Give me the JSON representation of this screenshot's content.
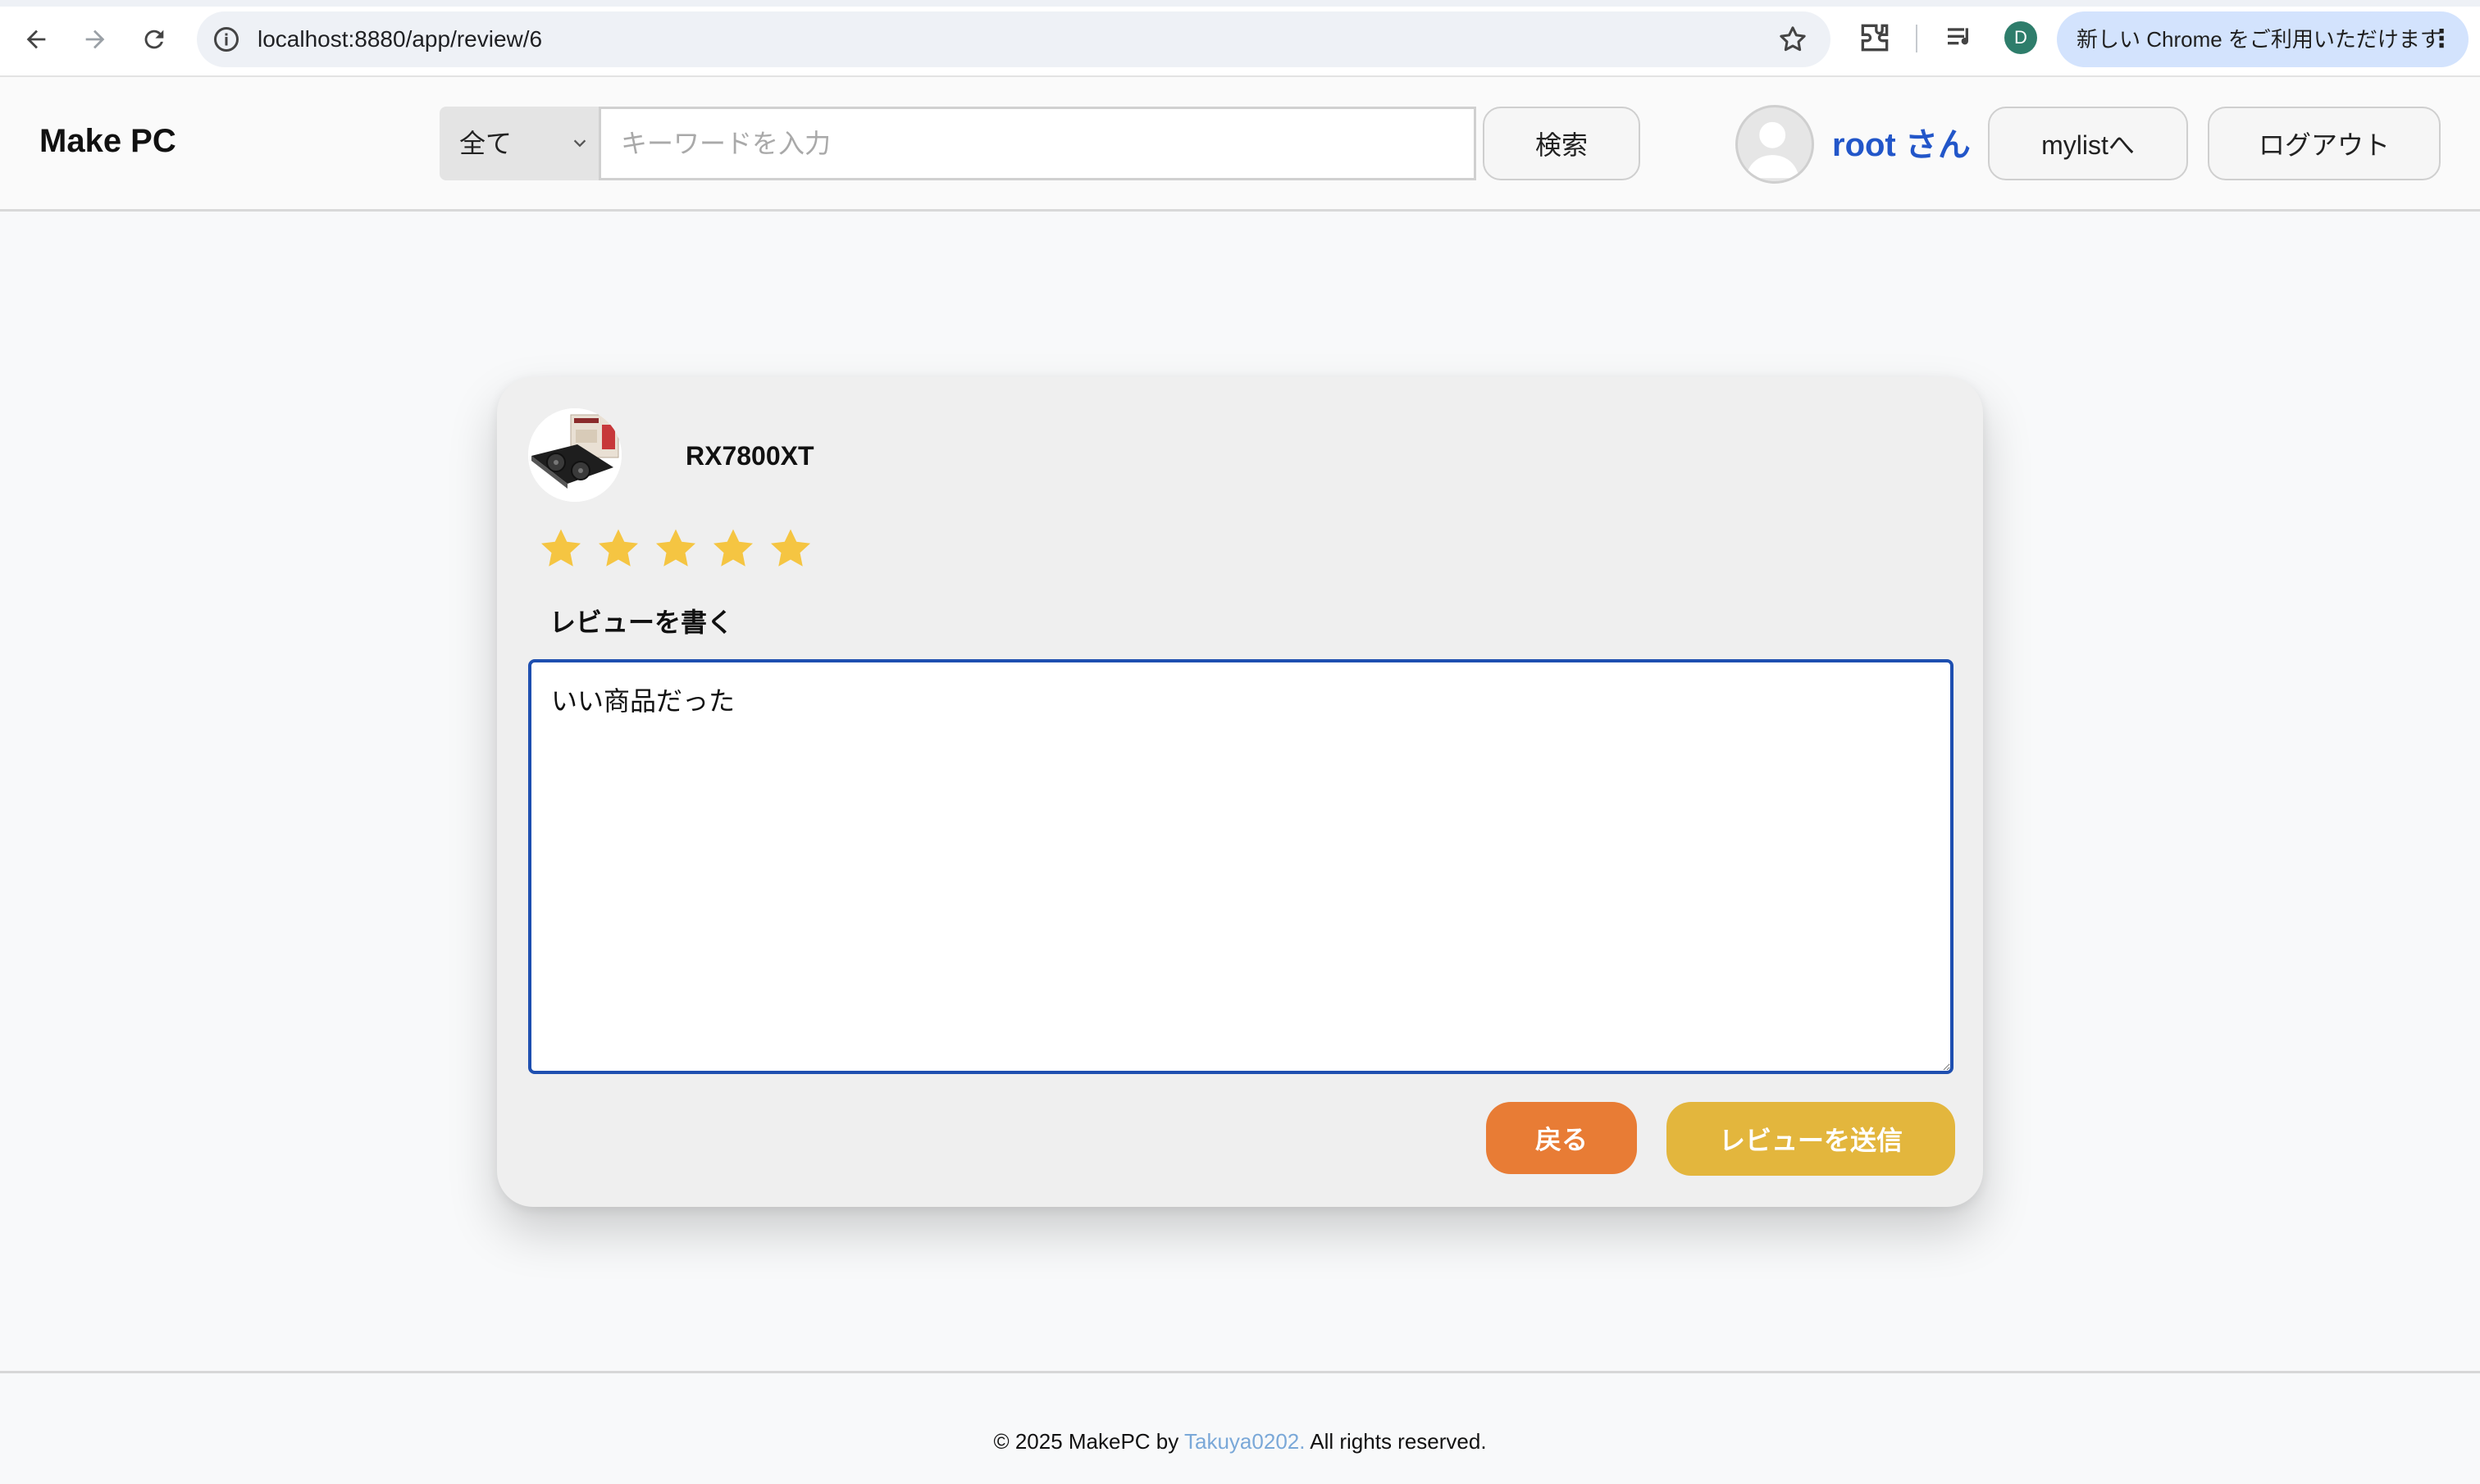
{
  "browser": {
    "url": "localhost:8880/app/review/6",
    "profile_initial": "D",
    "update_label": "新しい Chrome をご利用いただけます",
    "menu_glyph": "⋮"
  },
  "header": {
    "logo": "Make PC",
    "category_selected": "全て",
    "search_placeholder": "キーワードを入力",
    "search_button": "検索",
    "username": "root さん",
    "mylist_button": "mylistへ",
    "logout_button": "ログアウト",
    "accent_color": "#2256c9"
  },
  "review": {
    "product_name": "RX7800XT",
    "rating": 5,
    "rating_max": 5,
    "star_color": "#f5c542",
    "label": "レビューを書く",
    "text": "いい商品だった",
    "back_button": "戻る",
    "submit_button": "レビューを送信",
    "back_color": "#e87c35",
    "submit_color": "#e3b63d"
  },
  "footer": {
    "prefix": "© 2025 MakePC by ",
    "author": "Takuya0202.",
    "suffix": " All rights reserved."
  }
}
